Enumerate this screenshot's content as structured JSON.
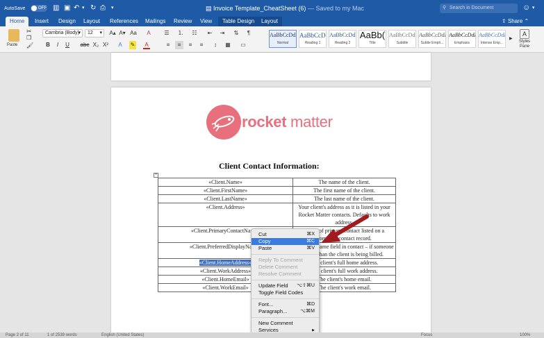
{
  "titlebar": {
    "autosave_label": "AutoSave",
    "autosave_state": "OFF",
    "doc_name": "Invoice Template_CheatSheet (6)",
    "saved_status": "— Saved to my Mac",
    "search_placeholder": "Search in Document"
  },
  "tabs": [
    {
      "label": "Home"
    },
    {
      "label": "Insert"
    },
    {
      "label": "Design"
    },
    {
      "label": "Layout"
    },
    {
      "label": "References"
    },
    {
      "label": "Mailings"
    },
    {
      "label": "Review"
    },
    {
      "label": "View"
    },
    {
      "label": "Table Design"
    },
    {
      "label": "Layout"
    }
  ],
  "share_label": "Share",
  "ribbon": {
    "paste_label": "Paste",
    "font_name": "Cambria (Body)",
    "font_size": "12",
    "styles_pane_label": "Styles Pane",
    "styles": [
      {
        "preview": "AaBbCcDdEe",
        "name": "Normal"
      },
      {
        "preview": "AaBbCcDc",
        "name": "Heading 1"
      },
      {
        "preview": "AaBbCcDdE",
        "name": "Heading 2"
      },
      {
        "preview": "AaBb(",
        "name": "Title"
      },
      {
        "preview": "AaBbCcDdE",
        "name": "Subtitle"
      },
      {
        "preview": "AaBbCcDdEe",
        "name": "Subtle Emph..."
      },
      {
        "preview": "AaBbCcDdEe",
        "name": "Emphasis"
      },
      {
        "preview": "AaBbCcDdEe",
        "name": "Intense Emp..."
      }
    ]
  },
  "document": {
    "logo_text_bold": "rocket",
    "logo_text_light": "matter",
    "heading": "Client Contact Information:",
    "rows": [
      {
        "field": "«Client.Name»",
        "desc": "The name of the client."
      },
      {
        "field": "«Client.FirstName»",
        "desc": "The first name of the client."
      },
      {
        "field": "«Client.LastName»",
        "desc": "The last name of the client."
      },
      {
        "field": "«Client.Address»",
        "desc": "Your client's address as it is listed in your Rocket Matter contacts. Defaults to work address."
      },
      {
        "field": "«Client.PrimaryContactName»",
        "desc": "Name of primary contact listed on a company contact record."
      },
      {
        "field": "«Client.PreferredDisplayName»",
        "desc": "Preferred name field in contact – if someone other than the client is being billed."
      },
      {
        "field": "«Client.HomeAddress»",
        "desc": "The client's full home address."
      },
      {
        "field": "«Client.WorkAddress»",
        "desc": "The client's full work address."
      },
      {
        "field": "«Client.HomeEmail»",
        "desc": "The client's home email."
      },
      {
        "field": "«Client.WorkEmail»",
        "desc": "The client's work email."
      }
    ]
  },
  "context_menu": {
    "items": [
      {
        "label": "Cut",
        "shortcut": "⌘X"
      },
      {
        "label": "Copy",
        "shortcut": "⌘C"
      },
      {
        "label": "Paste",
        "shortcut": "⌘V"
      },
      {
        "label": "Reply To Comment",
        "shortcut": ""
      },
      {
        "label": "Delete Comment",
        "shortcut": ""
      },
      {
        "label": "Resolve Comment",
        "shortcut": ""
      },
      {
        "label": "Update Field",
        "shortcut": "⌥⇧⌘U"
      },
      {
        "label": "Toggle Field Codes",
        "shortcut": ""
      },
      {
        "label": "Font...",
        "shortcut": "⌘D"
      },
      {
        "label": "Paragraph...",
        "shortcut": "⌥⌘M"
      },
      {
        "label": "New Comment",
        "shortcut": ""
      },
      {
        "label": "Services",
        "shortcut": "▶"
      }
    ]
  },
  "statusbar": {
    "page_info": "Page 2 of 11",
    "word_count": "1 of 2539 words",
    "language": "English (United States)",
    "focus": "Focus",
    "zoom": "100%"
  },
  "colors": {
    "titlebar": "#1f5aa6",
    "brand_logo": "#e8707d",
    "selection": "#3a7be0",
    "arrow": "#a01a1f"
  }
}
